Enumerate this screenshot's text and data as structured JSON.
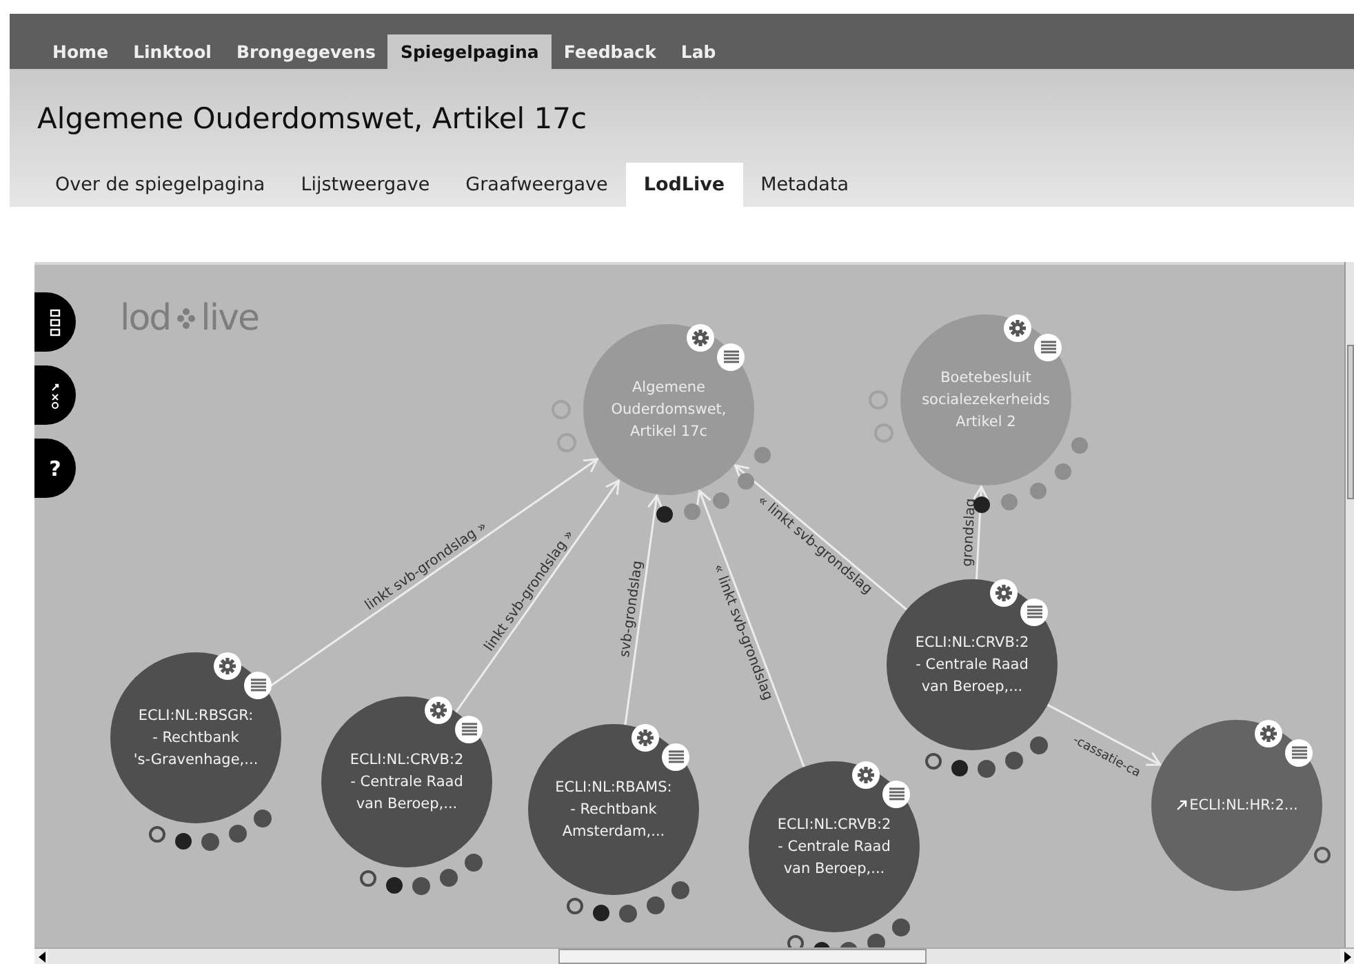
{
  "nav": {
    "tabs": [
      {
        "label": "Home",
        "selected": false
      },
      {
        "label": "Linktool",
        "selected": false
      },
      {
        "label": "Brongegevens",
        "selected": false
      },
      {
        "label": "Spiegelpagina",
        "selected": true
      },
      {
        "label": "Feedback",
        "selected": false
      },
      {
        "label": "Lab",
        "selected": false
      }
    ]
  },
  "title": "Algemene Ouderdomswet, Artikel 17c",
  "subtabs": [
    {
      "label": "Over de spiegelpagina",
      "selected": false
    },
    {
      "label": "Lijstweergave",
      "selected": false
    },
    {
      "label": "Graafweergave",
      "selected": false
    },
    {
      "label": "LodLive",
      "selected": true
    },
    {
      "label": "Metadata",
      "selected": false
    }
  ],
  "lodlive": {
    "logo": [
      "lod",
      "live"
    ],
    "tools": [
      {
        "kind": "boxes"
      },
      {
        "kind": "tools"
      },
      {
        "kind": "help",
        "label": "?"
      }
    ],
    "nodes": [
      {
        "kind": "focus",
        "lines": [
          "Algemene",
          "Ouderdomswet,",
          "Artikel 17c"
        ]
      },
      {
        "kind": "focus",
        "lines": [
          "Boetebesluit",
          "socialezekerheids",
          "Artikel 2"
        ]
      },
      {
        "kind": "result",
        "lines": [
          "ECLI:NL:RBSGR:",
          "- Rechtbank",
          "'s-Gravenhage,..."
        ]
      },
      {
        "kind": "result",
        "lines": [
          "ECLI:NL:CRVB:2",
          "- Centrale Raad",
          "van Beroep,..."
        ]
      },
      {
        "kind": "result",
        "lines": [
          "ECLI:NL:RBAMS:",
          "- Rechtbank",
          "Amsterdam,..."
        ]
      },
      {
        "kind": "result",
        "lines": [
          "ECLI:NL:CRVB:2",
          "- Centrale Raad",
          "van Beroep,..."
        ]
      },
      {
        "kind": "result",
        "lines": [
          "ECLI:NL:CRVB:2",
          "- Centrale Raad",
          "van Beroep,..."
        ]
      },
      {
        "kind": "remote",
        "lines": [
          "ECLI:NL:HR:2..."
        ]
      }
    ],
    "edges": [
      {
        "label": "linkt svb-grondslag »"
      },
      {
        "label": "linkt svb-grondslag »"
      },
      {
        "label": "svb-grondslag"
      },
      {
        "label": "« linkt svb-grondslag"
      },
      {
        "label": "« linkt svb-grondslag"
      },
      {
        "label": "grondslag"
      },
      {
        "label": "-cassatie-ca"
      }
    ]
  }
}
